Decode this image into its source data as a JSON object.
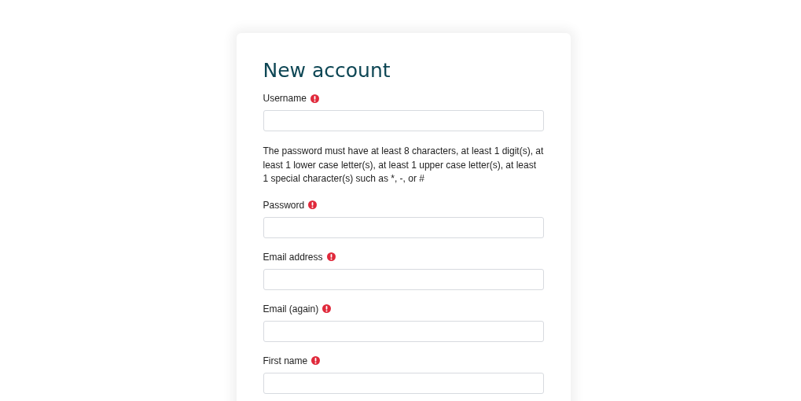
{
  "title": "New account",
  "items": [
    {
      "kind": "field",
      "label": "Username",
      "required": true
    },
    {
      "kind": "note",
      "text": "The password must have at least 8 characters, at least 1 digit(s), at least 1 lower case letter(s), at least 1 upper case letter(s), at least 1 special character(s) such as *, -, or #"
    },
    {
      "kind": "field",
      "label": "Password",
      "required": true
    },
    {
      "kind": "field",
      "label": "Email address",
      "required": true
    },
    {
      "kind": "field",
      "label": "Email (again)",
      "required": true
    },
    {
      "kind": "field",
      "label": "First name",
      "required": true
    }
  ]
}
